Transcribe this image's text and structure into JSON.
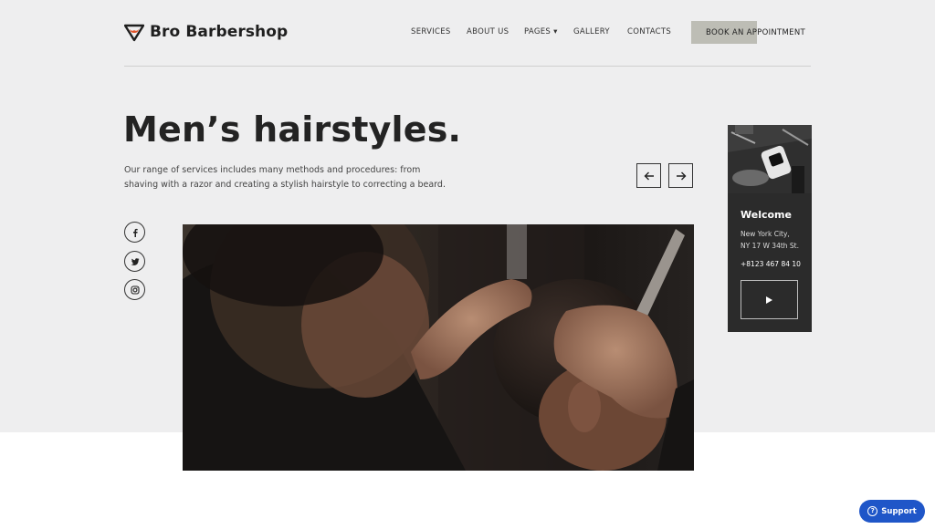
{
  "brand": {
    "name": "Bro Barbershop",
    "logo_icon": "barber-mustache-logo",
    "accent": "#e2552b"
  },
  "nav": {
    "services": "SERVICES",
    "about": "ABOUT US",
    "pages": "PAGES ▾",
    "gallery": "GALLERY",
    "contacts": "CONTACTS",
    "book": "BOOK AN APPOINTMENT"
  },
  "hero": {
    "title": "Men’s hairstyles.",
    "description": "Our range of services includes many methods and procedures: from shaving with a razor and creating a stylish hairstyle to correcting a beard."
  },
  "social": {
    "icons": [
      "facebook-icon",
      "twitter-icon",
      "instagram-icon"
    ]
  },
  "card": {
    "title": "Welcome",
    "address_line1": "New York City,",
    "address_line2": "NY 17 W 34th St.",
    "phone": "+8123 467 84 10"
  },
  "support": {
    "label": "Support"
  },
  "colors": {
    "hero_bg": "#eeeeef",
    "card_bg": "#2b2b2b",
    "support_bg": "#1f56c8"
  }
}
